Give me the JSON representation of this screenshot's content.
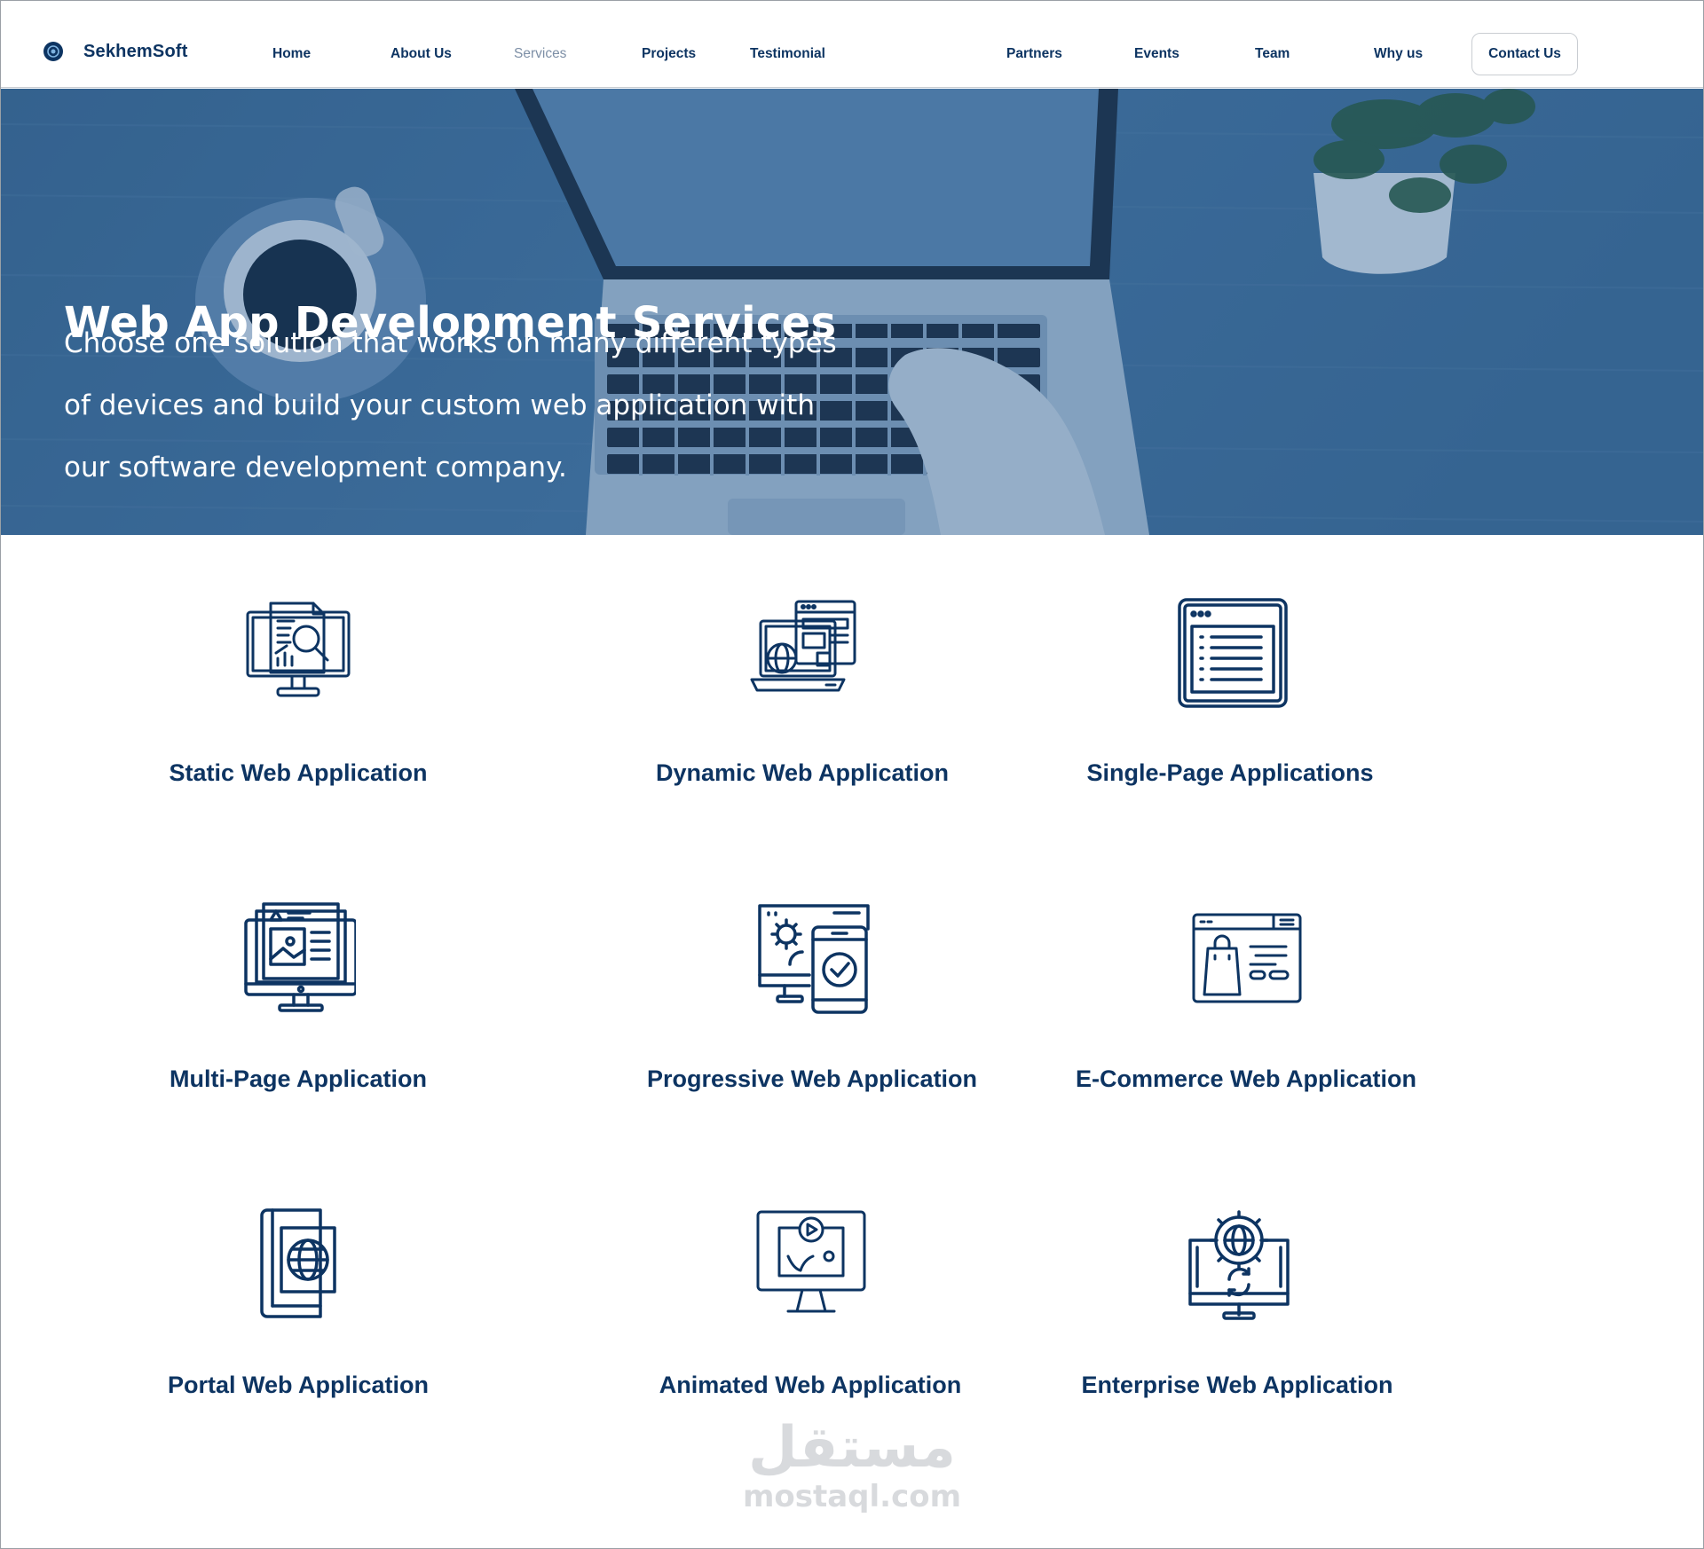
{
  "brand": {
    "name": "SekhemSoft"
  },
  "nav": {
    "items": [
      {
        "label": "Home",
        "active": false
      },
      {
        "label": "About Us",
        "active": false
      },
      {
        "label": "Services",
        "active": true
      },
      {
        "label": "Projects",
        "active": false
      },
      {
        "label": "Testimonial",
        "active": false
      },
      {
        "label": "Partners",
        "active": false
      },
      {
        "label": "Events",
        "active": false
      },
      {
        "label": "Team",
        "active": false
      },
      {
        "label": "Why us",
        "active": false
      }
    ],
    "contact_label": "Contact Us"
  },
  "hero": {
    "title": "Web App Development Services",
    "lines": [
      "Choose one solution that works on many different types",
      "of devices and build your custom web application with",
      "our software development company."
    ]
  },
  "services": [
    {
      "label": "Static Web Application",
      "icon": "monitor-report-search-icon"
    },
    {
      "label": "Dynamic Web Application",
      "icon": "laptop-globe-windows-icon"
    },
    {
      "label": "Single-Page Applications",
      "icon": "browser-list-page-icon"
    },
    {
      "label": "Multi-Page Application",
      "icon": "monitor-multi-page-icon"
    },
    {
      "label": "Progressive Web Application",
      "icon": "desktop-gear-mobile-check-icon"
    },
    {
      "label": "E-Commerce Web Application",
      "icon": "browser-shopping-bag-icon"
    },
    {
      "label": "Portal Web Application",
      "icon": "book-globe-portal-icon"
    },
    {
      "label": "Animated Web Application",
      "icon": "monitor-play-animation-icon"
    },
    {
      "label": "Enterprise Web Application",
      "icon": "monitor-gear-globe-sync-icon"
    }
  ],
  "watermark": {
    "arabic": "مستقل",
    "latin": "mostaql.com"
  },
  "colors": {
    "brand": "#0d3462",
    "hero_overlay": "#3f6d97",
    "active_nav": "#7d8fa6"
  }
}
